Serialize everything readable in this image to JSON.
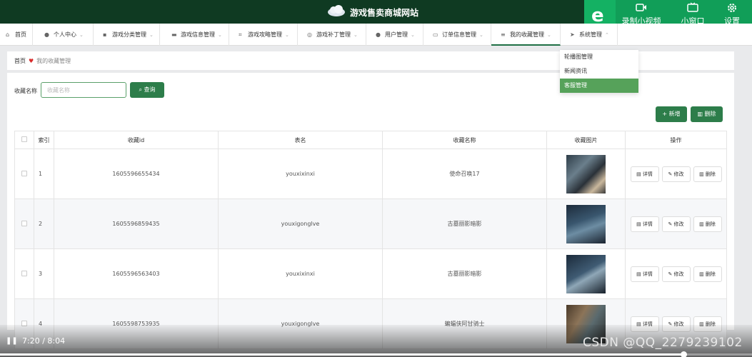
{
  "site": {
    "title": "游戏售卖商城网站"
  },
  "ext": {
    "record_label": "录制小视频",
    "mini_label": "小窗口",
    "settings_label": "设置"
  },
  "nav": {
    "items": [
      {
        "label": "首页"
      },
      {
        "label": "个人中心"
      },
      {
        "label": "游戏分类管理"
      },
      {
        "label": "游戏信息管理"
      },
      {
        "label": "游戏攻略管理"
      },
      {
        "label": "游戏补丁管理"
      },
      {
        "label": "用户管理"
      },
      {
        "label": "订单信息管理"
      },
      {
        "label": "我的收藏管理"
      },
      {
        "label": "系统管理"
      }
    ]
  },
  "dropdown": {
    "items": [
      "轮播图管理",
      "新闻资讯",
      "客服管理"
    ]
  },
  "breadcrumb": {
    "home": "首页",
    "current": "我的收藏管理"
  },
  "search": {
    "label": "收藏名称",
    "placeholder": "收藏名称",
    "query_label": "查询"
  },
  "actions": {
    "add_label": "新增",
    "delete_label": "删除"
  },
  "table": {
    "headers": {
      "index": "索引",
      "id": "收藏id",
      "table": "表名",
      "name": "收藏名称",
      "image": "收藏图片",
      "ops": "操作"
    },
    "ops": {
      "detail": "详情",
      "edit": "修改",
      "delete": "删除"
    },
    "rows": [
      {
        "index": "1",
        "id": "1605596655434",
        "table": "youxixinxi",
        "name": "使命召唤17"
      },
      {
        "index": "2",
        "id": "1605596859435",
        "table": "youxigonglve",
        "name": "古墓丽影暗影"
      },
      {
        "index": "3",
        "id": "1605596563403",
        "table": "youxixinxi",
        "name": "古墓丽影暗影"
      },
      {
        "index": "4",
        "id": "1605598753935",
        "table": "youxigonglve",
        "name": "蝙蝠侠阿甘骑士"
      }
    ]
  },
  "video": {
    "time": "7:20 / 8:04",
    "watermark": "CSDN @QQ_2279239102",
    "progress": 0.9087
  },
  "icons": {
    "home": "home-icon",
    "user": "user-icon",
    "category": "category-icon",
    "info": "info-icon",
    "guide": "guide-icon",
    "patch": "patch-icon",
    "users": "users-icon",
    "order": "order-icon",
    "favorites": "favorites-icon",
    "system": "system-icon"
  },
  "colors": {
    "header": "#0f3a22",
    "accent": "#2d7d4a",
    "extension": "#119e58"
  }
}
